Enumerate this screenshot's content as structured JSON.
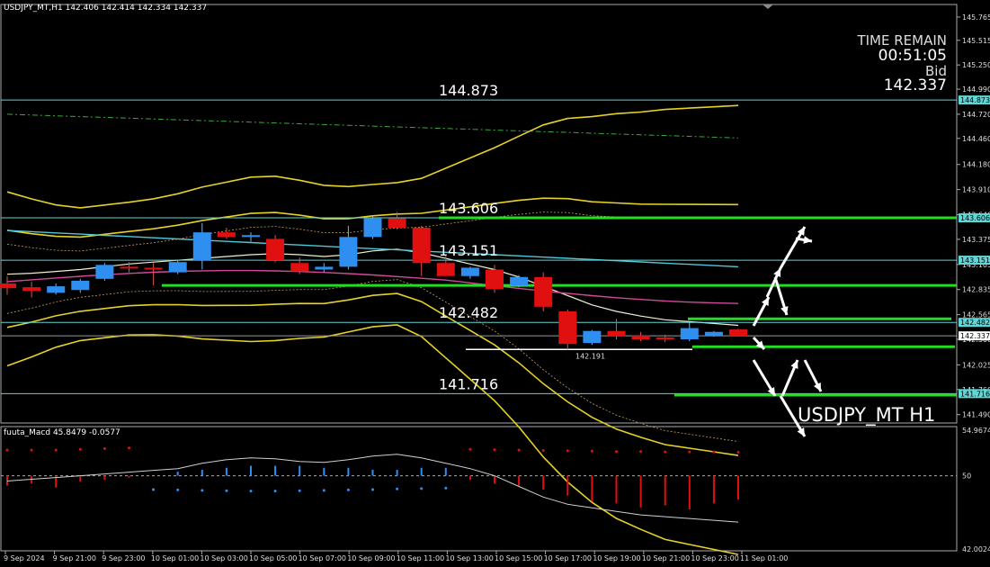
{
  "header": {
    "symbol_info": "USDJPY_MT,H1",
    "ohlc": "142.406 142.414 142.334 142.337"
  },
  "timer": {
    "label": "TIME REMAIN",
    "value": "00:51:05",
    "bid_label": "Bid",
    "bid_value": "142.337"
  },
  "watermark": "USDJPY_MT H1",
  "levels": [
    {
      "label": "144.873",
      "price": 144.873,
      "color": "#5fd6d6"
    },
    {
      "label": "143.606",
      "price": 143.606,
      "color": "#5fd6d6"
    },
    {
      "label": "143.151",
      "price": 143.151,
      "color": "#5fd6d6"
    },
    {
      "label": "142.482",
      "price": 142.482,
      "color": "#5fd6d6"
    },
    {
      "label": "141.716",
      "price": 141.716,
      "color": "#5fd6d6"
    }
  ],
  "current_price": {
    "label": "142.337",
    "price": 142.337
  },
  "low_marker": {
    "label": "142.191",
    "price": 142.191
  },
  "price_axis": [
    "145.765",
    "145.515",
    "145.250",
    "144.990",
    "144.720",
    "144.460",
    "144.180",
    "143.910",
    "143.640",
    "143.375",
    "143.105",
    "142.835",
    "142.565",
    "142.300",
    "142.025",
    "141.760",
    "141.490"
  ],
  "time_axis": [
    "9 Sep 2024",
    "9 Sep 21:00",
    "9 Sep 23:00",
    "10 Sep 01:00",
    "10 Sep 03:00",
    "10 Sep 05:00",
    "10 Sep 07:00",
    "10 Sep 09:00",
    "10 Sep 11:00",
    "10 Sep 13:00",
    "10 Sep 15:00",
    "10 Sep 17:00",
    "10 Sep 19:00",
    "10 Sep 21:00",
    "10 Sep 23:00",
    "11 Sep 01:00"
  ],
  "macd": {
    "label": "fuuta_Macd",
    "value1": "45.8479",
    "value2": "-0.0577",
    "axis": [
      "54.9674",
      "50",
      "42.0024"
    ]
  },
  "colors": {
    "bull": "#2f8ff0",
    "bear": "#e01010",
    "level": "#5fd6d6",
    "green": "#22dd22",
    "band": "#e6d227",
    "grid": "#888888"
  },
  "chart_data": {
    "type": "candlestick",
    "candles": [
      {
        "o": 142.9,
        "h": 142.98,
        "l": 142.78,
        "c": 142.85
      },
      {
        "o": 142.86,
        "h": 142.92,
        "l": 142.75,
        "c": 142.82
      },
      {
        "o": 142.8,
        "h": 142.9,
        "l": 142.78,
        "c": 142.87
      },
      {
        "o": 142.83,
        "h": 142.95,
        "l": 142.8,
        "c": 142.93
      },
      {
        "o": 142.95,
        "h": 143.12,
        "l": 142.93,
        "c": 143.1
      },
      {
        "o": 143.08,
        "h": 143.13,
        "l": 143.02,
        "c": 143.07
      },
      {
        "o": 143.07,
        "h": 143.12,
        "l": 142.88,
        "c": 143.05
      },
      {
        "o": 143.02,
        "h": 143.15,
        "l": 143.0,
        "c": 143.13
      },
      {
        "o": 143.15,
        "h": 143.55,
        "l": 143.05,
        "c": 143.45
      },
      {
        "o": 143.45,
        "h": 143.5,
        "l": 143.38,
        "c": 143.4
      },
      {
        "o": 143.4,
        "h": 143.45,
        "l": 143.35,
        "c": 143.42
      },
      {
        "o": 143.38,
        "h": 143.42,
        "l": 143.13,
        "c": 143.15
      },
      {
        "o": 143.12,
        "h": 143.18,
        "l": 143.0,
        "c": 143.03
      },
      {
        "o": 143.05,
        "h": 143.12,
        "l": 143.02,
        "c": 143.08
      },
      {
        "o": 143.08,
        "h": 143.52,
        "l": 143.05,
        "c": 143.4
      },
      {
        "o": 143.4,
        "h": 143.62,
        "l": 143.38,
        "c": 143.6
      },
      {
        "o": 143.6,
        "h": 143.67,
        "l": 143.48,
        "c": 143.5
      },
      {
        "o": 143.5,
        "h": 143.52,
        "l": 142.98,
        "c": 143.12
      },
      {
        "o": 143.12,
        "h": 143.2,
        "l": 142.98,
        "c": 142.98
      },
      {
        "o": 142.98,
        "h": 143.08,
        "l": 142.95,
        "c": 143.07
      },
      {
        "o": 143.05,
        "h": 143.1,
        "l": 142.8,
        "c": 142.84
      },
      {
        "o": 142.88,
        "h": 142.99,
        "l": 142.86,
        "c": 142.97
      },
      {
        "o": 142.97,
        "h": 143.02,
        "l": 142.6,
        "c": 142.65
      },
      {
        "o": 142.6,
        "h": 142.62,
        "l": 142.19,
        "c": 142.25
      },
      {
        "o": 142.26,
        "h": 142.4,
        "l": 142.24,
        "c": 142.39
      },
      {
        "o": 142.39,
        "h": 142.52,
        "l": 142.3,
        "c": 142.33
      },
      {
        "o": 142.34,
        "h": 142.38,
        "l": 142.28,
        "c": 142.3
      },
      {
        "o": 142.32,
        "h": 142.35,
        "l": 142.27,
        "c": 142.3
      },
      {
        "o": 142.3,
        "h": 142.48,
        "l": 142.28,
        "c": 142.42
      },
      {
        "o": 142.34,
        "h": 142.39,
        "l": 142.33,
        "c": 142.38
      },
      {
        "o": 142.406,
        "h": 142.414,
        "l": 142.334,
        "c": 142.337
      }
    ],
    "ylim": [
      141.4,
      145.9
    ],
    "macd_hist": [
      -0.5,
      -0.4,
      -0.6,
      -0.3,
      -0.2,
      -0.1,
      0.0,
      0.2,
      0.3,
      0.4,
      0.5,
      0.5,
      0.5,
      0.4,
      0.4,
      0.3,
      0.3,
      0.4,
      0.4,
      -0.2,
      -0.4,
      -0.5,
      -0.7,
      -1.0,
      -1.3,
      -1.4,
      -1.6,
      -1.5,
      -1.7,
      -1.4,
      -1.2
    ],
    "macd_line": [
      -0.3,
      -0.2,
      -0.1,
      0.0,
      0.1,
      0.2,
      0.3,
      0.4,
      0.7,
      0.9,
      1.0,
      0.95,
      0.8,
      0.75,
      0.9,
      1.1,
      1.2,
      1.0,
      0.7,
      0.4,
      0.0,
      -0.6,
      -1.2,
      -1.6,
      -1.8,
      -2.0,
      -2.2,
      -2.3,
      -2.4,
      -2.5,
      -2.6
    ],
    "macd_signal_dots": [
      0.8,
      0.8,
      0.8,
      0.6,
      0.4,
      0.2,
      0.1,
      0.0,
      -0.1,
      -0.2,
      -0.3,
      -0.3,
      -0.2,
      -0.1,
      0.0,
      0.1,
      0.3,
      0.4,
      0.5,
      0.6,
      0.7,
      0.8,
      0.9,
      1.0,
      1.1,
      1.2,
      1.2,
      1.3,
      1.3,
      1.3,
      1.4
    ]
  }
}
